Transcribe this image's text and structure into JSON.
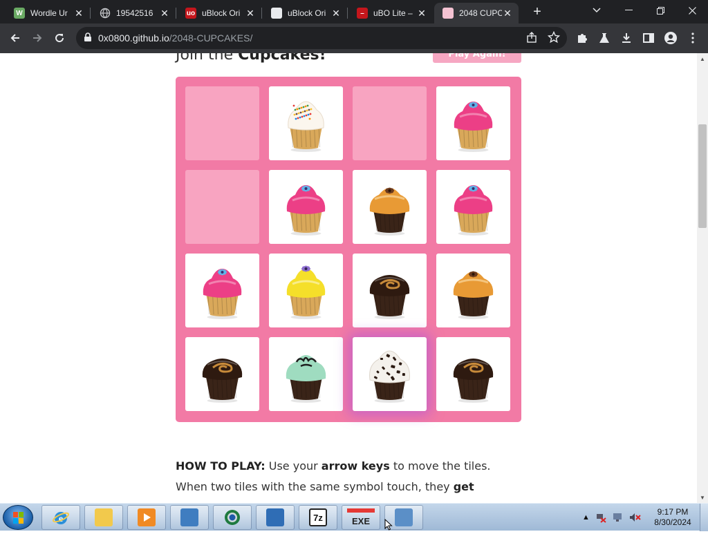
{
  "browser": {
    "tabs": [
      {
        "title": "Wordle Ur",
        "icon": "wordle-w-icon",
        "color": "#6aaa64",
        "glyph": "W"
      },
      {
        "title": "19542516",
        "icon": "globe-icon",
        "color": "#9aa0a6",
        "glyph": ""
      },
      {
        "title": "uBlock Ori",
        "icon": "ublock-origin-icon",
        "color": "#c4161c",
        "glyph": "uo"
      },
      {
        "title": "uBlock Ori",
        "icon": "ublock-wiki-icon",
        "color": "#e8eaed",
        "glyph": ""
      },
      {
        "title": "uBO Lite –",
        "icon": "ubo-lite-icon",
        "color": "#c4161c",
        "glyph": "–"
      },
      {
        "title": "2048 CUPC",
        "icon": "cupcake-favicon-icon",
        "color": "#f4c2d2",
        "glyph": ""
      }
    ],
    "active_tab": 5,
    "url_host": "0x0800.github.io",
    "url_path": "/2048-CUPCAKES/"
  },
  "page": {
    "heading_prefix": "Join the ",
    "heading_bold": "Cupcakes!",
    "play_again_label": "Play Again!",
    "howto": {
      "p1": "HOW TO PLAY:",
      "p2": " Use your ",
      "p3": "arrow keys",
      "p4": " to move the tiles. When two tiles with the same symbol touch, they ",
      "p5": "get promoted!"
    }
  },
  "board": {
    "rows": [
      [
        "empty",
        "sprinkles-vanilla",
        "empty",
        "pink-frosting-flower"
      ],
      [
        "empty",
        "pink-frosting-flower",
        "caramel-chocolate",
        "pink-frosting-flower"
      ],
      [
        "pink-frosting-flower",
        "yellow-frosting-flower",
        "chocolate-swirl",
        "caramel-chocolate"
      ],
      [
        "chocolate-swirl",
        "mint-chocolate",
        "cookies-and-cream",
        "chocolate-swirl"
      ]
    ],
    "highlighted": [
      [
        3,
        2
      ]
    ],
    "colors": {
      "board_bg": "#f27aa5",
      "empty_cell": "#f8a4c1",
      "pink_frosting": "#ec3f86",
      "yellow_frosting": "#f5df2a",
      "caramel": "#e89a35",
      "mint": "#9fdcc0",
      "chocolate": "#3a2418",
      "vanilla_cake": "#d9a85a"
    }
  },
  "taskbar": {
    "apps": [
      {
        "name": "internet-explorer",
        "icon": "internet-explorer-icon"
      },
      {
        "name": "file-explorer",
        "icon": "folder-icon"
      },
      {
        "name": "media-player",
        "icon": "media-player-icon"
      },
      {
        "name": "control-panel",
        "icon": "control-panel-icon"
      },
      {
        "name": "chrome",
        "icon": "chrome-icon"
      },
      {
        "name": "upload-tool",
        "icon": "upload-tool-icon"
      },
      {
        "name": "7zip",
        "icon": "7zip-icon",
        "label": "7z"
      },
      {
        "name": "youtube-exe",
        "icon": "youtube-exe-icon",
        "label": "EXE"
      },
      {
        "name": "remote-desktop",
        "icon": "remote-desktop-icon"
      }
    ],
    "time": "9:17 PM",
    "date": "8/30/2024"
  }
}
